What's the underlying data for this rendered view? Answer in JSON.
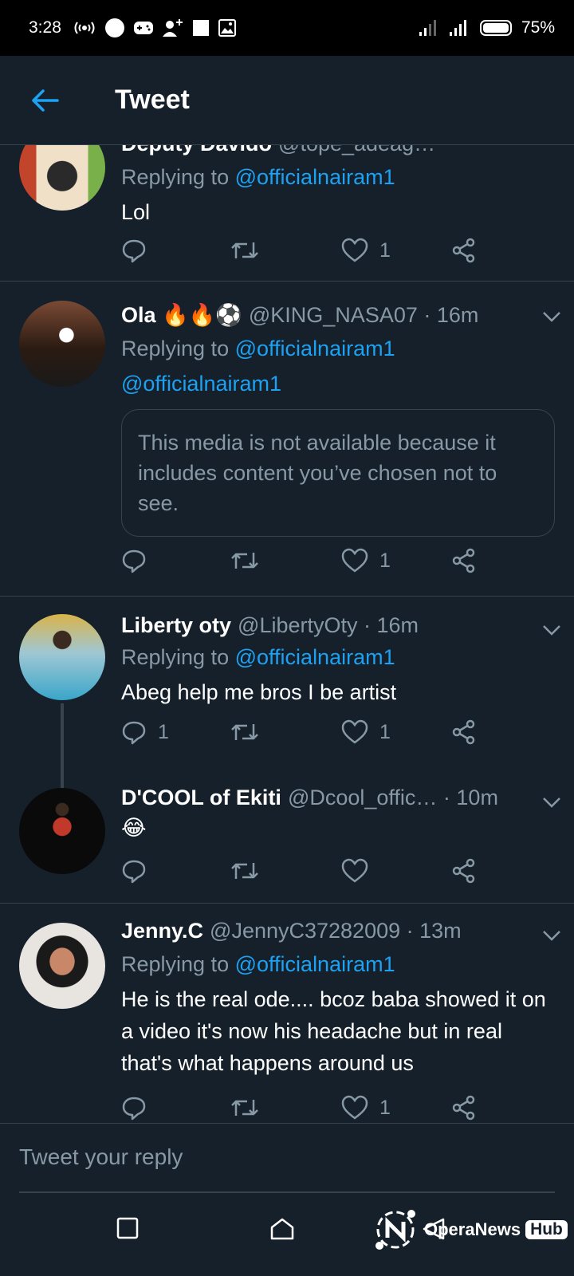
{
  "status": {
    "time": "3:28",
    "battery": "75%"
  },
  "header": {
    "title": "Tweet"
  },
  "tweets": [
    {
      "name": "Deputy Davido",
      "handle": "@tope_adeag…",
      "replying_prefix": "Replying to",
      "replying_to": "@officialnairam1",
      "text": "Lol",
      "likes": "1"
    },
    {
      "name": "Ola 🔥🔥⚽",
      "handle": "@KING_NASA07 · 16m",
      "replying_prefix": "Replying to",
      "replying_to": "@officialnairam1",
      "mention": "@officialnairam1",
      "media_notice": "This media is not available because it includes content you’ve chosen not to see.",
      "likes": "1"
    },
    {
      "name": "Liberty oty",
      "handle": "@LibertyOty · 16m",
      "replying_prefix": "Replying to",
      "replying_to": "@officialnairam1",
      "text": "Abeg help me bros I be artist",
      "replies": "1",
      "likes": "1"
    },
    {
      "name": "D'COOL of Ekiti",
      "handle": "@Dcool_offic… · 10m",
      "text": "😂"
    },
    {
      "name": "Jenny.C",
      "handle": "@JennyC37282009 · 13m",
      "replying_prefix": "Replying to",
      "replying_to": "@officialnairam1",
      "text": "He is the real ode.... bcoz baba showed it on a video it's now his headache but in real that's what happens around us",
      "likes": "1"
    }
  ],
  "reply_bar": {
    "placeholder": "Tweet your reply"
  },
  "watermark": {
    "brand": "OperaNews",
    "hub": "Hub"
  }
}
